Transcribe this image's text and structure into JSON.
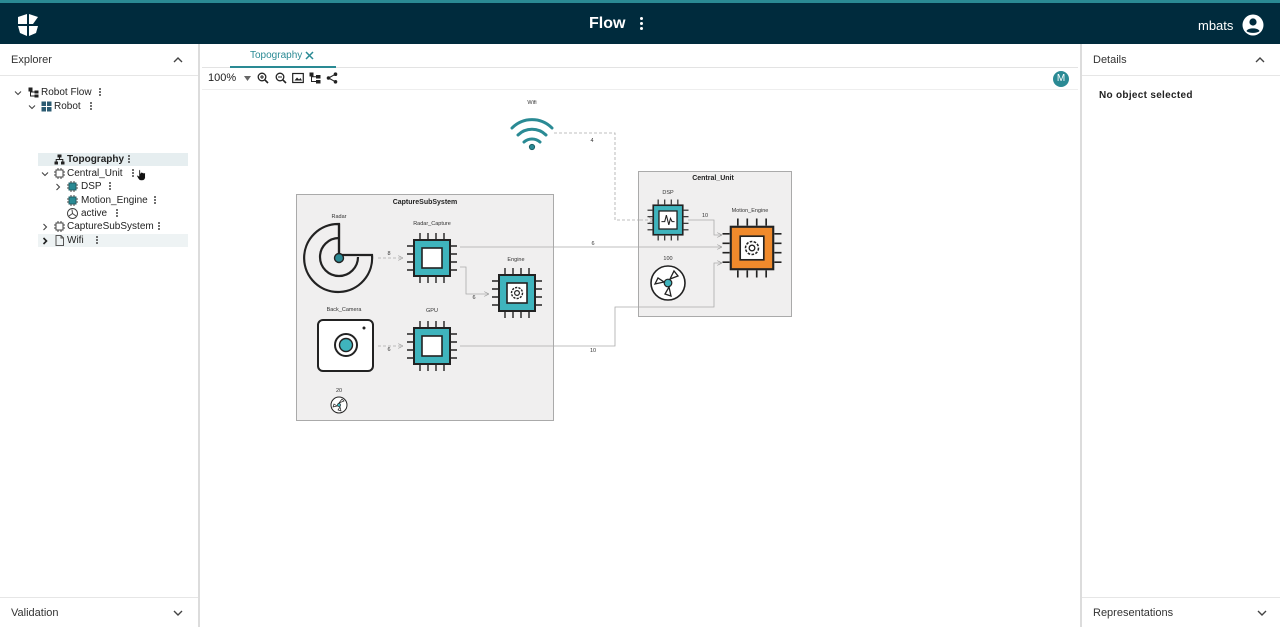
{
  "header": {
    "app_title": "Flow",
    "username": "mbats",
    "colors": {
      "bar": "#002b3d",
      "accent": "#2a8a94"
    }
  },
  "explorer": {
    "title": "Explorer",
    "tree": [
      {
        "label": "Robot Flow",
        "icon": "flow-root-icon"
      },
      {
        "label": "Robot",
        "icon": "system-grid-icon"
      },
      {
        "label": "Topography",
        "icon": "topography-icon",
        "selected": true
      },
      {
        "label": "Central_Unit",
        "icon": "chip-icon"
      },
      {
        "label": "DSP",
        "icon": "chip-icon"
      },
      {
        "label": "Motion_Engine",
        "icon": "chip-icon"
      },
      {
        "label": "active",
        "icon": "fan-icon"
      },
      {
        "label": "CaptureSubSystem",
        "icon": "chip-icon"
      },
      {
        "label": "Wifi",
        "icon": "file-icon"
      }
    ]
  },
  "validation": {
    "title": "Validation"
  },
  "editor": {
    "tab_label": "Topography",
    "zoom_level": "100%",
    "avatar_letter": "M"
  },
  "diagram": {
    "wifi_label": "Wifi",
    "capture_title": "CaptureSubSystem",
    "central_title": "Central_Unit",
    "radar_label": "Radar",
    "radar_capture_label": "Radar_Capture",
    "engine_label": "Engine",
    "back_camera_label": "Back_Camera",
    "gpu_label": "GPU",
    "dsp_label": "DSP",
    "motion_engine_label": "Motion_Engine",
    "fan_central_value": "100",
    "fan_capture_value": "20",
    "edge_wifi_dsp": "4",
    "edge_radar_rc": "8",
    "edge_rc_engine": "6",
    "edge_rc_motion": "6",
    "edge_cam_gpu": "6",
    "edge_gpu_motion": "10",
    "edge_dsp_motion": "10"
  },
  "details": {
    "title": "Details",
    "empty_text": "No object selected"
  },
  "representations": {
    "title": "Representations"
  }
}
